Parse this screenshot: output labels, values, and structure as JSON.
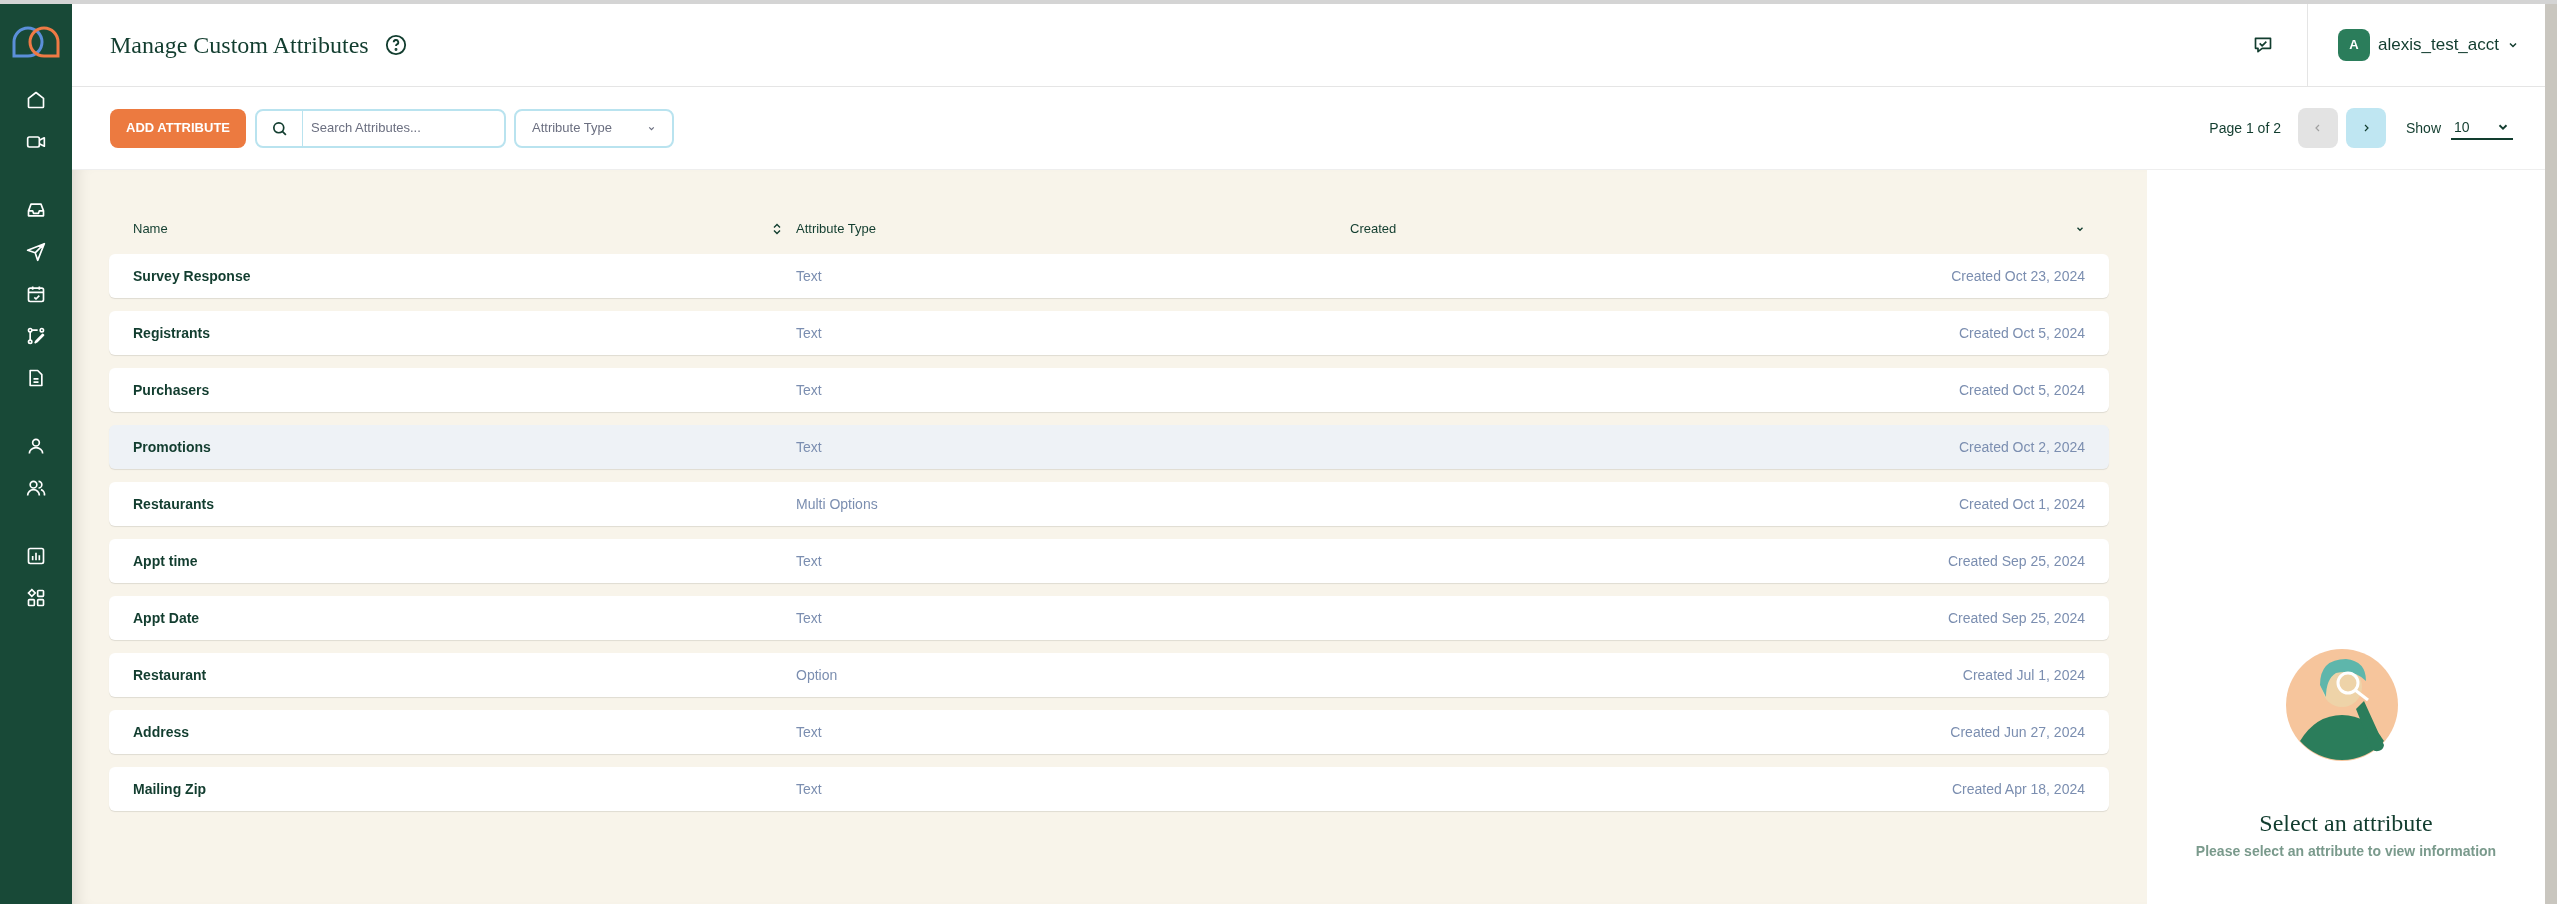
{
  "header": {
    "title": "Manage Custom Attributes",
    "account": {
      "avatar_letter": "A",
      "username": "alexis_test_acct"
    }
  },
  "toolbar": {
    "add_button": "ADD ATTRIBUTE",
    "search": {
      "placeholder": "Search Attributes..."
    },
    "filter": "Attribute Type",
    "pagination": {
      "label": "Page 1 of 2",
      "prev_disabled": true,
      "next_disabled": false
    },
    "show": {
      "label": "Show",
      "value": "10"
    }
  },
  "table": {
    "columns": [
      "Name",
      "Attribute Type",
      "Created"
    ],
    "rows": [
      {
        "name": "Survey Response",
        "type": "Text",
        "created": "Created Oct 23, 2024",
        "hovered": false
      },
      {
        "name": "Registrants",
        "type": "Text",
        "created": "Created Oct 5, 2024",
        "hovered": false
      },
      {
        "name": "Purchasers",
        "type": "Text",
        "created": "Created Oct 5, 2024",
        "hovered": false
      },
      {
        "name": "Promotions",
        "type": "Text",
        "created": "Created Oct 2, 2024",
        "hovered": true
      },
      {
        "name": "Restaurants",
        "type": "Multi Options",
        "created": "Created Oct 1, 2024",
        "hovered": false
      },
      {
        "name": "Appt time",
        "type": "Text",
        "created": "Created Sep 25, 2024",
        "hovered": false
      },
      {
        "name": "Appt Date",
        "type": "Text",
        "created": "Created Sep 25, 2024",
        "hovered": false
      },
      {
        "name": "Restaurant",
        "type": "Option",
        "created": "Created Jul 1, 2024",
        "hovered": false
      },
      {
        "name": "Address",
        "type": "Text",
        "created": "Created Jun 27, 2024",
        "hovered": false
      },
      {
        "name": "Mailing Zip",
        "type": "Text",
        "created": "Created Apr 18, 2024",
        "hovered": false
      }
    ]
  },
  "detail_panel": {
    "title": "Select an attribute",
    "message": "Please select an attribute to view information"
  }
}
